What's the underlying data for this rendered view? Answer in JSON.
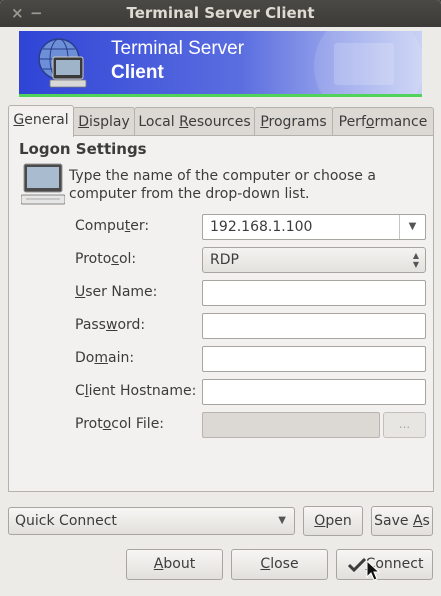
{
  "window": {
    "title": "Terminal Server Client",
    "close_glyph": "×",
    "minimize_glyph": "−"
  },
  "banner": {
    "line1": "Terminal Server",
    "line2": "Client"
  },
  "tabs": [
    {
      "pre": "",
      "u": "G",
      "post": "eneral"
    },
    {
      "pre": "",
      "u": "D",
      "post": "isplay"
    },
    {
      "pre": "Local ",
      "u": "R",
      "post": "esources"
    },
    {
      "pre": "",
      "u": "P",
      "post": "rograms"
    },
    {
      "pre": "Perf",
      "u": "o",
      "post": "rmance"
    }
  ],
  "logon": {
    "title": "Logon Settings",
    "description": "Type the name of the computer or choose a computer from the drop-down list.",
    "computer": {
      "pre": "Compu",
      "u": "t",
      "post": "er:",
      "value": "192.168.1.100"
    },
    "protocol": {
      "pre": "Proto",
      "u": "c",
      "post": "ol:",
      "value": "RDP"
    },
    "username": {
      "pre": "",
      "u": "U",
      "post": "ser Name:",
      "value": ""
    },
    "password": {
      "pre": "Pass",
      "u": "w",
      "post": "ord:",
      "value": ""
    },
    "domain": {
      "pre": "Do",
      "u": "m",
      "post": "ain:",
      "value": ""
    },
    "hostname": {
      "pre": "C",
      "u": "l",
      "post": "ient Hostname:",
      "value": ""
    },
    "protocol_file": {
      "pre": "Prot",
      "u": "o",
      "post": "col File:",
      "value": "",
      "browse": "..."
    }
  },
  "quick_connect": {
    "value": "Quick Connect"
  },
  "buttons": {
    "open": {
      "pre": "",
      "u": "O",
      "post": "pen"
    },
    "save_as": {
      "pre": "Save ",
      "u": "A",
      "post": "s"
    },
    "about": {
      "pre": "",
      "u": "A",
      "post": "bout"
    },
    "close": {
      "pre": "",
      "u": "C",
      "post": "lose"
    },
    "connect": {
      "pre": "",
      "u": "C",
      "post": "onnect"
    }
  },
  "icons": {
    "banner": "computer-globe-icon",
    "logon": "computer-monitor-icon",
    "connect": "checkmark-icon",
    "cursor": "mouse-pointer-icon"
  },
  "colors": {
    "banner_blue": "#2f44d6",
    "banner_green": "#4fd35a",
    "titlebar": "#3c3b37"
  }
}
